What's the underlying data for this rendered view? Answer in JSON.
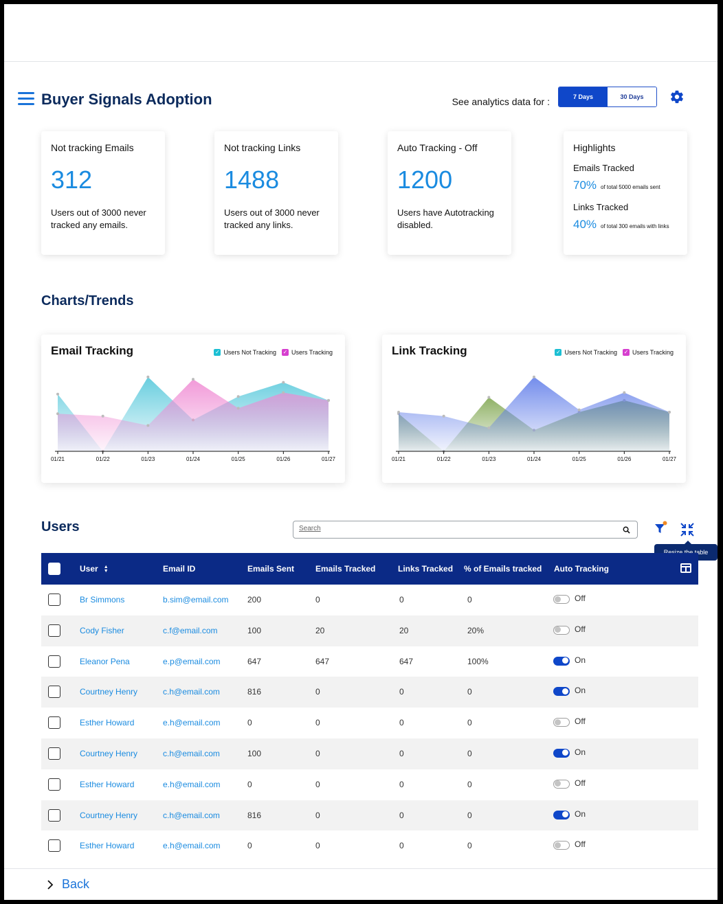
{
  "header": {
    "title": "Buyer Signals Adoption",
    "analytics_label": "See analytics data for :",
    "ranges": [
      "7 Days",
      "30 Days"
    ],
    "active_range": "7 Days"
  },
  "cards": [
    {
      "title": "Not tracking Emails",
      "value": "312",
      "desc": "Users out of  3000 never tracked any emails."
    },
    {
      "title": "Not tracking Links",
      "value": "1488",
      "desc": "Users out of  3000 never tracked any links."
    },
    {
      "title": "Auto Tracking - Off",
      "value": "1200",
      "desc": "Users have Autotracking disabled."
    }
  ],
  "highlights": {
    "title": "Highlights",
    "emails_label": "Emails Tracked",
    "emails_pct": "70%",
    "emails_note": "of total 5000 emails sent",
    "links_label": "Links Tracked",
    "links_pct": "40%",
    "links_note": "of total 300 emails with links"
  },
  "charts_section": {
    "title": "Charts/Trends"
  },
  "colors": {
    "primary": "#0f47c9",
    "navy": "#0b2a86",
    "accent_blue": "#1a8be0",
    "not_tracking": "#1cbfd3",
    "tracking": "#d63fcf"
  },
  "chart_data": [
    {
      "type": "area",
      "title": "Email Tracking",
      "x": [
        "01/21",
        "01/22",
        "01/23",
        "01/24",
        "01/25",
        "01/26",
        "01/27"
      ],
      "series": [
        {
          "name": "Users Not Tracking",
          "color": "#4dc5d9",
          "values": [
            73,
            0,
            95,
            40,
            70,
            88,
            65
          ]
        },
        {
          "name": "Users Tracking",
          "color": "#ef88d2",
          "values": [
            48,
            45,
            33,
            92,
            55,
            75,
            65
          ]
        }
      ],
      "legend": "top-right",
      "ylim": [
        0,
        100
      ]
    },
    {
      "type": "area",
      "title": "Link Tracking",
      "x": [
        "01/21",
        "01/22",
        "01/23",
        "01/24",
        "01/25",
        "01/26",
        "01/27"
      ],
      "series": [
        {
          "name": "Users Not Tracking",
          "color": "#7ba34a",
          "values": [
            48,
            0,
            69,
            27,
            50,
            65,
            50
          ]
        },
        {
          "name": "Users Tracking",
          "color": "#5a78e8",
          "values": [
            50,
            45,
            30,
            95,
            53,
            75,
            50
          ]
        }
      ],
      "legend": "top-right",
      "ylim": [
        0,
        100
      ]
    }
  ],
  "users": {
    "title": "Users",
    "search_placeholder": "Search",
    "tooltip": "Resize the table",
    "columns": [
      "User",
      "Email ID",
      "Emails Sent",
      "Emails Tracked",
      "Links Tracked",
      "% of Emails tracked",
      "Auto Tracking"
    ],
    "rows": [
      {
        "name": "Br Simmons",
        "email": "b.sim@email.com",
        "sent": "200",
        "tracked": "0",
        "links": "0",
        "pct": "0",
        "auto": "Off"
      },
      {
        "name": "Cody Fisher",
        "email": "c.f@email.com",
        "sent": "100",
        "tracked": "20",
        "links": "20",
        "pct": "20%",
        "auto": "Off"
      },
      {
        "name": "Eleanor Pena",
        "email": "e.p@email.com",
        "sent": "647",
        "tracked": "647",
        "links": "647",
        "pct": "100%",
        "auto": "On"
      },
      {
        "name": "Courtney Henry",
        "email": "c.h@email.com",
        "sent": "816",
        "tracked": "0",
        "links": "0",
        "pct": "0",
        "auto": "On"
      },
      {
        "name": "Esther Howard",
        "email": "e.h@email.com",
        "sent": "0",
        "tracked": "0",
        "links": "0",
        "pct": "0",
        "auto": "Off"
      },
      {
        "name": "Courtney Henry",
        "email": "c.h@email.com",
        "sent": "100",
        "tracked": "0",
        "links": "0",
        "pct": "0",
        "auto": "On"
      },
      {
        "name": "Esther Howard",
        "email": "e.h@email.com",
        "sent": "0",
        "tracked": "0",
        "links": "0",
        "pct": "0",
        "auto": "Off"
      },
      {
        "name": "Courtney Henry",
        "email": "c.h@email.com",
        "sent": "816",
        "tracked": "0",
        "links": "0",
        "pct": "0",
        "auto": "On"
      },
      {
        "name": "Esther Howard",
        "email": "e.h@email.com",
        "sent": "0",
        "tracked": "0",
        "links": "0",
        "pct": "0",
        "auto": "Off"
      }
    ]
  },
  "footer": {
    "back_label": "Back"
  }
}
